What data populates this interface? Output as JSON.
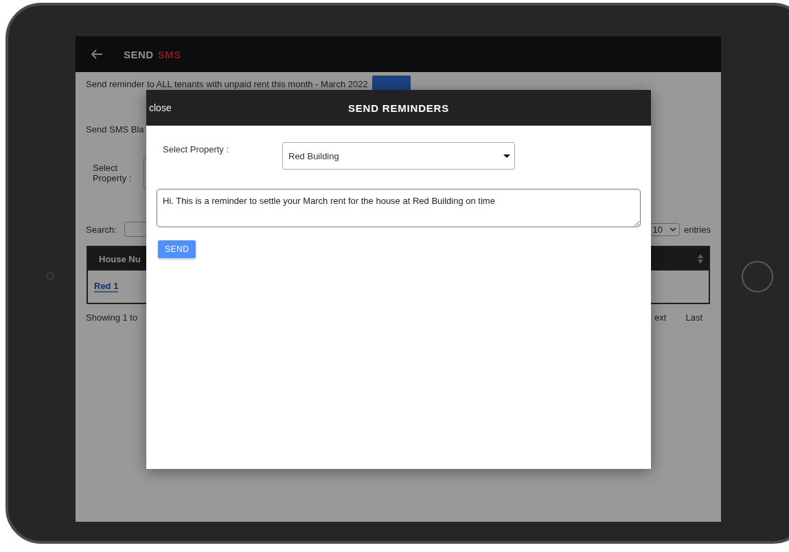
{
  "app_bar": {
    "title": "SEND",
    "title_accent": "SMS"
  },
  "background": {
    "reminder_all": "Send reminder to ALL tenants with unpaid rent this month - March 2022",
    "sms_blast_label": "Send SMS Bla",
    "select_property_label": "Select Property :",
    "search_label": "Search:",
    "page_size": "10",
    "entries_label": "entries",
    "table": {
      "columns": [
        "House Nu"
      ],
      "rows": [
        {
          "house": "Red 1"
        }
      ]
    },
    "showing": "Showing 1 to",
    "pagination": [
      "ext",
      "Last"
    ]
  },
  "modal": {
    "close": "close",
    "title": "SEND REMINDERS",
    "property_label": "Select Property :",
    "property_value": "Red Building",
    "message": "Hi. This is a reminder to settle your March rent for the house at Red Building on time",
    "send_button": "SEND"
  }
}
